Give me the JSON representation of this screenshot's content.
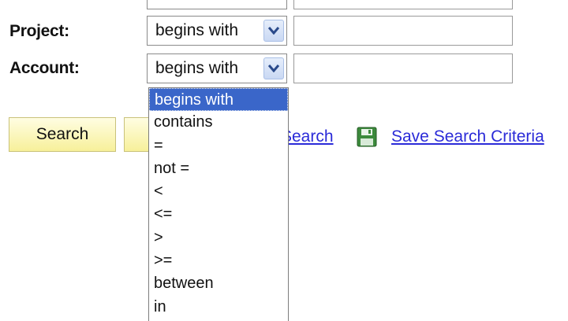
{
  "fields": [
    {
      "label": "Project:",
      "operator": "begins with",
      "value": ""
    },
    {
      "label": "Account:",
      "operator": "begins with",
      "value": ""
    }
  ],
  "buttons": {
    "search_label": "Search",
    "clear_label": ""
  },
  "links": {
    "basic_search_partial": "Search",
    "save_search_criteria": "Save Search Criteria"
  },
  "dropdown": {
    "selected_index": 0,
    "options": [
      "begins with",
      "contains",
      "=",
      "not =",
      "<",
      "<=",
      ">",
      ">=",
      "between",
      "in"
    ]
  },
  "icons": {
    "save": "floppy-disk-icon",
    "dropdown_arrow": "chevron-down-icon"
  },
  "colors": {
    "button_bg": "#f7f09a",
    "link": "#2b2bd8",
    "selected_option_bg": "#3a66c9",
    "arrow_bg": "#c9d8f3"
  }
}
